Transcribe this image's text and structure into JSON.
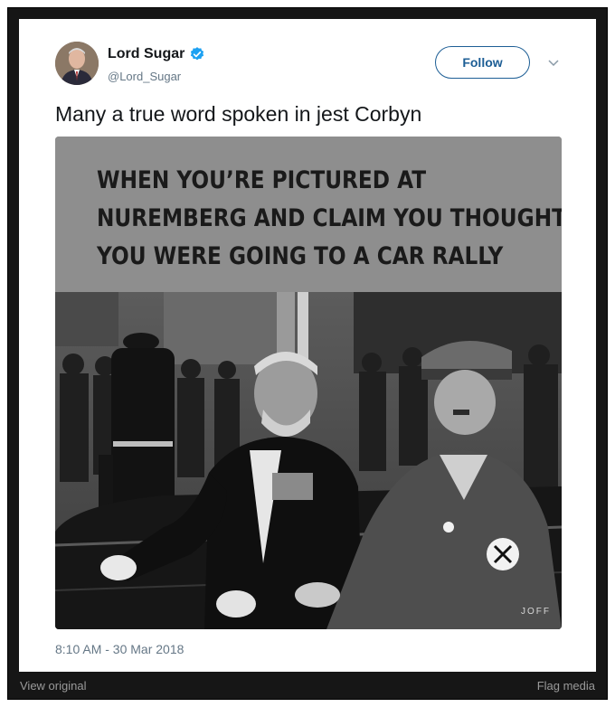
{
  "tweet": {
    "author": {
      "display_name": "Lord Sugar",
      "handle": "@Lord_Sugar",
      "verified": true
    },
    "follow_label": "Follow",
    "text": "Many a true word spoken in jest Corbyn",
    "meme_caption": [
      "WHEN YOU’RE PICTURED AT",
      "NUREMBERG AND CLAIM YOU THOUGHT",
      "YOU WERE GOING TO A CAR RALLY"
    ],
    "watermark": "JOFF",
    "timestamp": "8:10 AM - 30 Mar 2018"
  },
  "footer": {
    "view_original": "View original",
    "flag_media": "Flag media"
  },
  "colors": {
    "link_blue": "#1d5e95",
    "verified_blue": "#1da1f2",
    "frame": "#161616"
  }
}
